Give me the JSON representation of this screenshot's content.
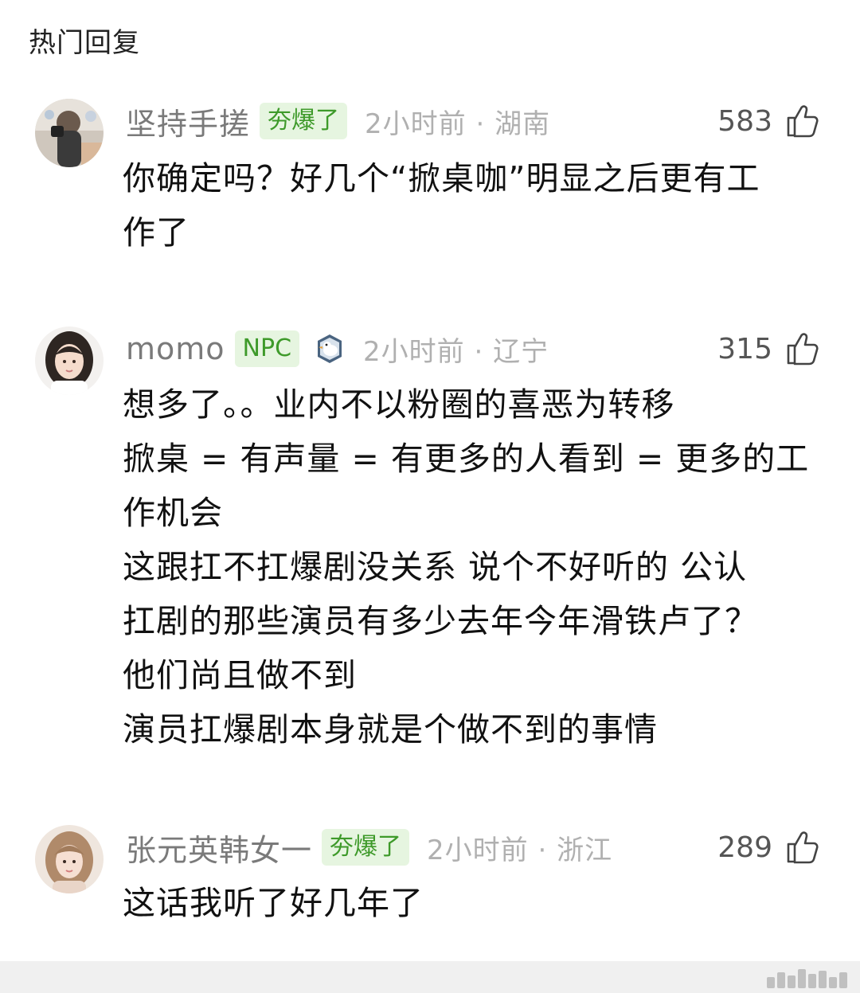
{
  "section_title": "热门回复",
  "comments": [
    {
      "username": "坚持手搓",
      "badge": "夯爆了",
      "time": "2小时前 · 湖南",
      "likes": "583",
      "content": "你确定吗？好几个“掀桌咖”明显之后更有工\n作了"
    },
    {
      "username": "momo",
      "badge": "NPC",
      "time": "2小时前 · 辽宁",
      "likes": "315",
      "content": "想多了。。业内不以粉圈的喜恶为转移\n掀桌 = 有声量 = 有更多的人看到 = 更多的工\n作机会\n这跟扛不扛爆剧没关系 说个不好听的 公认\n扛剧的那些演员有多少去年今年滑铁卢了？\n他们尚且做不到\n演员扛爆剧本身就是个做不到的事情"
    },
    {
      "username": "张元英韩女一",
      "badge": "夯爆了",
      "time": "2小时前 · 浙江",
      "likes": "289",
      "content": "这话我听了好几年了"
    }
  ],
  "icons": {
    "like": "thumbs-up-icon",
    "fan": "fan-badge-icon"
  },
  "colors": {
    "badge_bg": "#e6f5e0",
    "badge_text": "#3e9a2a",
    "meta_gray": "#7a7a7a",
    "time_gray": "#b0b0b0"
  }
}
